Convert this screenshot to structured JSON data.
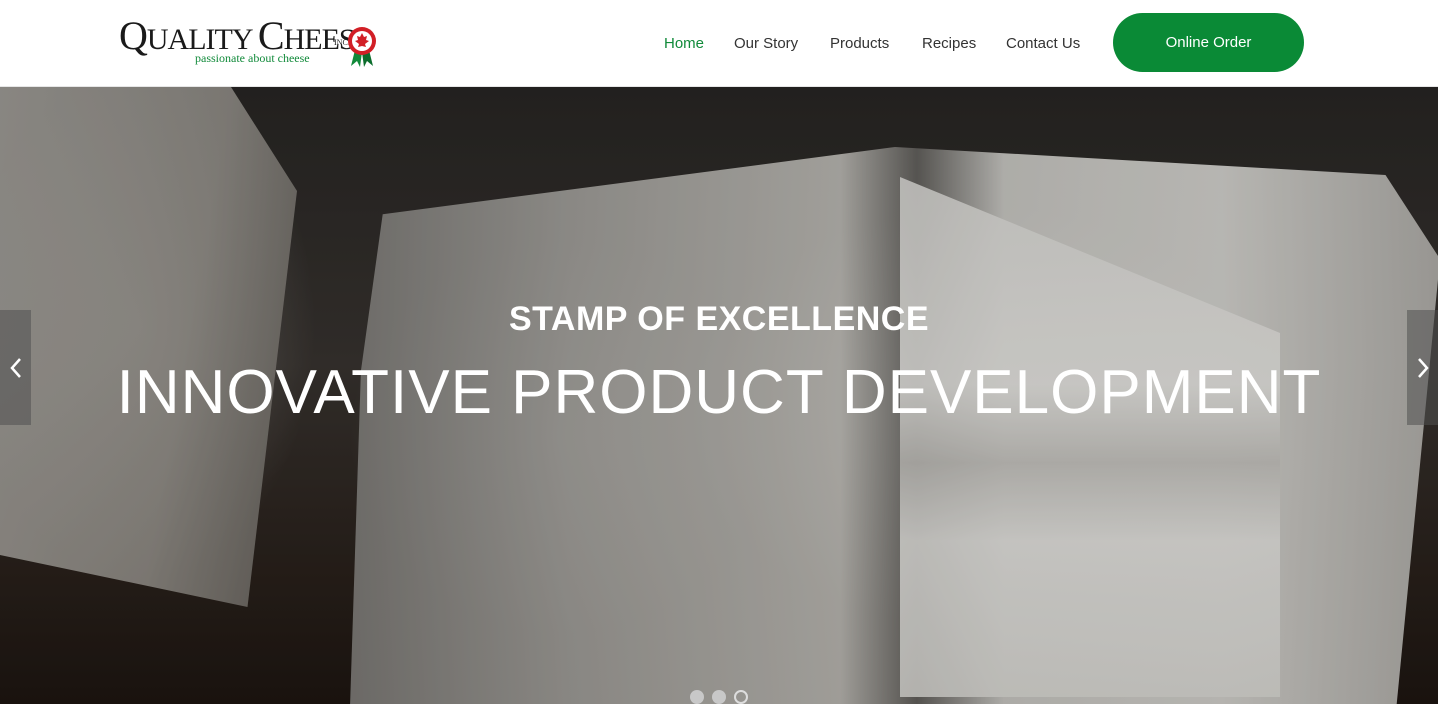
{
  "header": {
    "logo": {
      "brand_q": "Q",
      "brand_rest1": "UALITY ",
      "brand_c": "C",
      "brand_rest2": "HEESE",
      "brand_inc": "INC.",
      "tagline": "passionate about cheese"
    },
    "nav": [
      {
        "label": "Home",
        "active": true
      },
      {
        "label": "Our Story"
      },
      {
        "label": "Products"
      },
      {
        "label": "Recipes"
      },
      {
        "label": "Contact Us"
      }
    ],
    "order_button": "Online Order"
  },
  "hero": {
    "subtitle": "STAMP OF EXCELLENCE",
    "title": "INNOVATIVE PRODUCT DEVELOPMENT",
    "prev_icon": "‹",
    "next_icon": "›",
    "slides": 3,
    "active_slide": 3
  },
  "colors": {
    "accent_green": "#0a8a36",
    "nav_active": "#118a3a"
  },
  "icons": {
    "prev": "chevron-left-icon",
    "next": "chevron-right-icon",
    "logo_mark": "maple-leaf-rosette-icon"
  }
}
